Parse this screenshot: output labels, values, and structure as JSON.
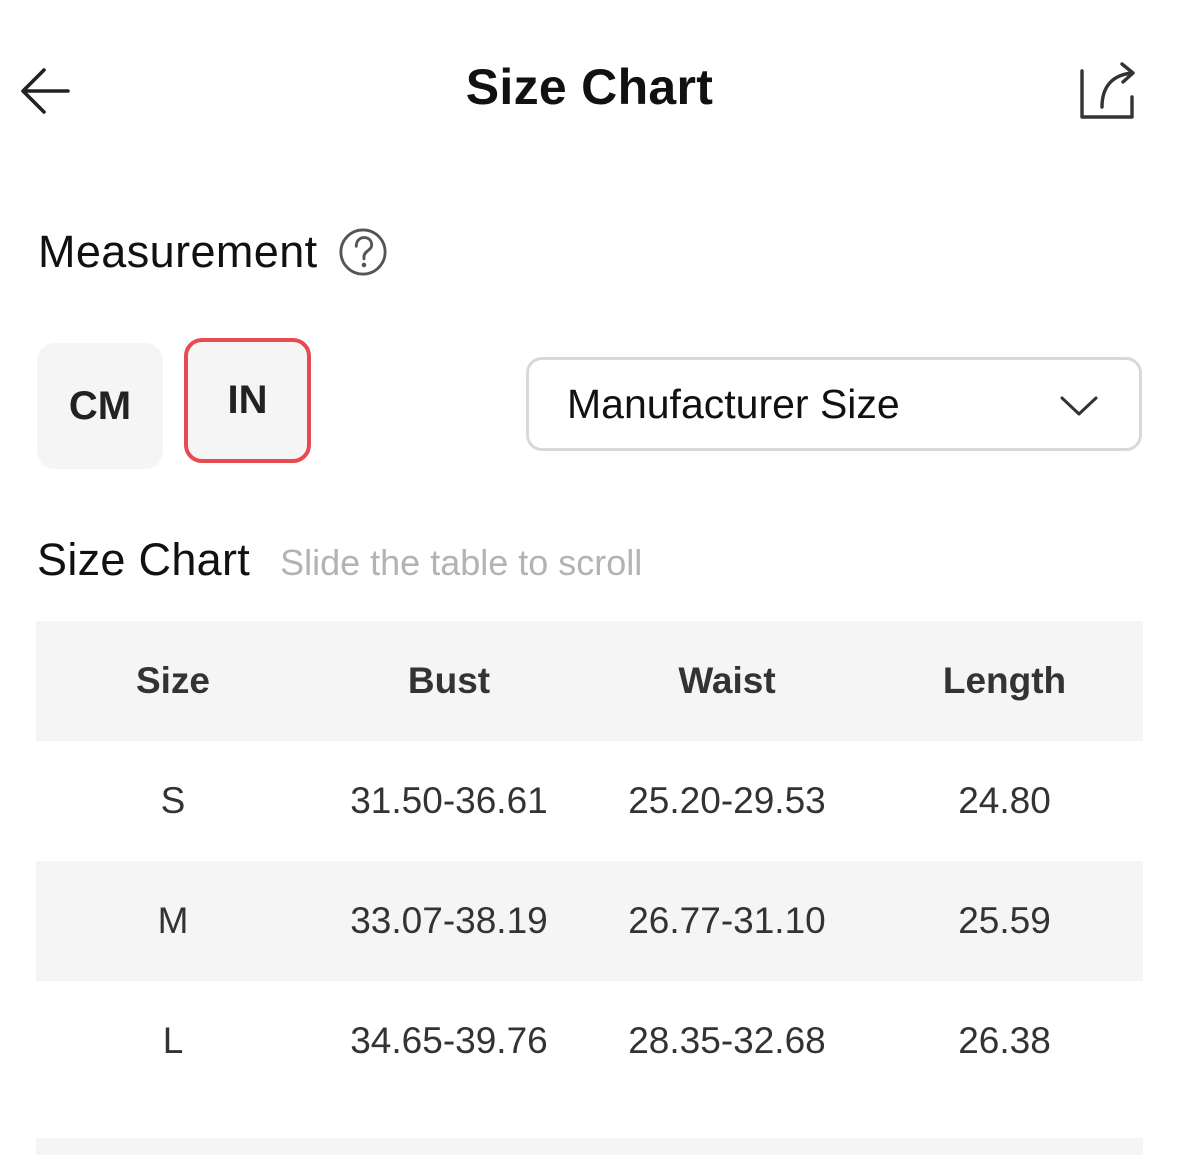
{
  "header": {
    "title": "Size Chart",
    "back_icon": "arrow-left-icon",
    "share_icon": "share-icon"
  },
  "measurement": {
    "label": "Measurement",
    "help_icon": "question-circle-icon",
    "units": [
      {
        "label": "CM",
        "selected": false
      },
      {
        "label": "IN",
        "selected": true
      }
    ],
    "size_system": {
      "selected": "Manufacturer Size",
      "icon": "chevron-down-icon"
    }
  },
  "size_chart": {
    "heading": "Size Chart",
    "hint": "Slide the table to scroll",
    "columns": [
      "Size",
      "Bust",
      "Waist",
      "Length"
    ],
    "rows": [
      [
        "S",
        "31.50-36.61",
        "25.20-29.53",
        "24.80"
      ],
      [
        "M",
        "33.07-38.19",
        "26.77-31.10",
        "25.59"
      ],
      [
        "L",
        "34.65-39.76",
        "28.35-32.68",
        "26.38"
      ]
    ]
  },
  "colors": {
    "selected_border": "#e84a4f",
    "chip_background": "#f5f5f5",
    "hint_text": "#b3b3b3"
  }
}
